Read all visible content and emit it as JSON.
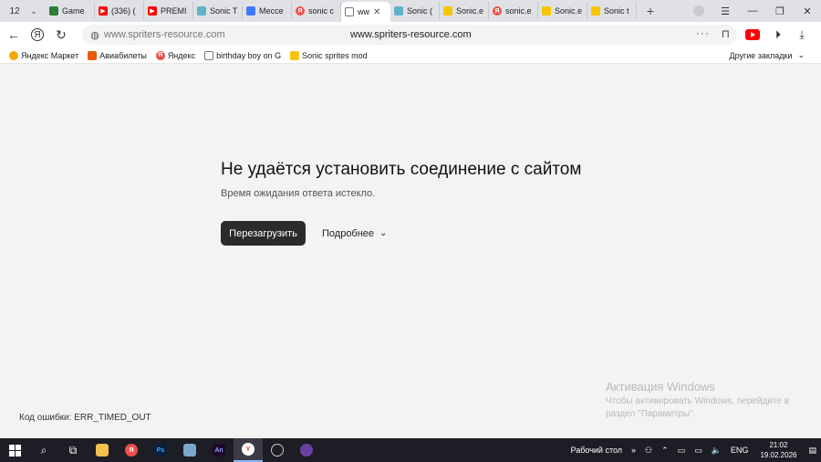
{
  "tabs": {
    "count": "12",
    "items": [
      {
        "label": "Game",
        "color": "#2e7d32",
        "icon": "game-icon"
      },
      {
        "label": "(336) (",
        "color": "#ff0000",
        "icon": "youtube-icon"
      },
      {
        "label": "PREMI",
        "color": "#ff0000",
        "icon": "youtube-icon"
      },
      {
        "label": "Sonic T",
        "color": "#5fb3c8",
        "icon": "sonic-icon"
      },
      {
        "label": "Мессе",
        "color": "#3d7bff",
        "icon": "messenger-icon"
      },
      {
        "label": "sonic c",
        "color": "#f04e4e",
        "icon": "yandex-icon"
      },
      {
        "label": "ww",
        "color": "#ffffff",
        "icon": "page-icon"
      },
      {
        "label": "Sonic (",
        "color": "#5fb3c8",
        "icon": "sonic-icon"
      },
      {
        "label": "Sonic.e",
        "color": "#f7c400",
        "icon": "spriters-icon"
      },
      {
        "label": "sonic.e",
        "color": "#f04e4e",
        "icon": "yandex-icon"
      },
      {
        "label": "Sonic.e",
        "color": "#f7c400",
        "icon": "spriters-icon"
      },
      {
        "label": "Sonic t",
        "color": "#f7c400",
        "icon": "spriters-icon"
      }
    ]
  },
  "toolbar": {
    "url_left": "www.spriters-resource.com",
    "url_center": "www.spriters-resource.com"
  },
  "bookmarks": {
    "items": [
      {
        "label": "Яндекс Маркет",
        "color": "#f7a600",
        "icon": "market-icon"
      },
      {
        "label": "Авиабилеты",
        "color": "#e85a0c",
        "icon": "avia-icon"
      },
      {
        "label": "Яндекс",
        "color": "#f04e4e",
        "icon": "yandex-icon"
      },
      {
        "label": "birthday boy on G",
        "color": "#ffffff",
        "icon": "page-icon"
      },
      {
        "label": "Sonic sprites mod",
        "color": "#f7c400",
        "icon": "spriters-icon"
      }
    ],
    "other": "Другие закладки"
  },
  "error": {
    "title": "Не удаётся установить соединение с сайтом",
    "subtitle": "Время ожидания ответа истекло.",
    "reload": "Перезагрузить",
    "details": "Подробнее",
    "code": "Код ошибки: ERR_TIMED_OUT"
  },
  "activation": {
    "title": "Активация Windows",
    "text": "Чтобы активировать Windows, перейдите в раздел \"Параметры\"."
  },
  "taskbar": {
    "desktop": "Рабочий стол",
    "lang": "ENG",
    "time": "21:02",
    "date": "19.02.2026"
  }
}
